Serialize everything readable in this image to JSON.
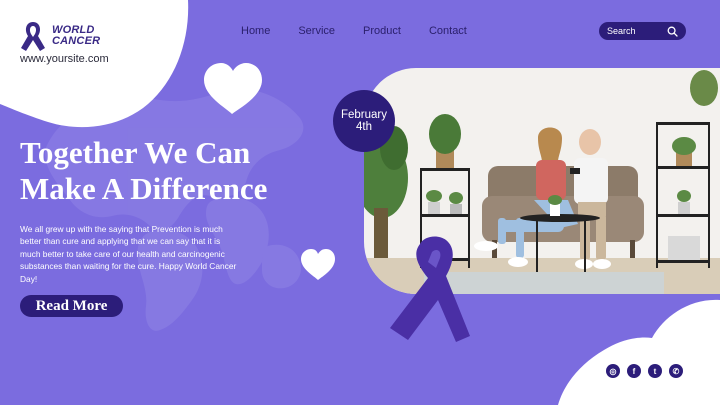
{
  "brand": {
    "name_line1": "WORLD",
    "name_line2": "CANCER",
    "site_url": "www.yoursite.com"
  },
  "nav": {
    "items": [
      {
        "label": "Home"
      },
      {
        "label": "Service"
      },
      {
        "label": "Product"
      },
      {
        "label": "Contact"
      }
    ]
  },
  "search": {
    "label": "Search",
    "icon": "search-icon"
  },
  "hero": {
    "headline_line1": "Together We Can",
    "headline_line2": "Make A Difference",
    "body": "We all grew up with the saying that Prevention is much better than cure and applying that we can say that it is much better to take care of our health and carcinogenic substances than waiting for the cure. Happy World Cancer Day!",
    "cta_label": "Read More"
  },
  "date_badge": {
    "line1": "February",
    "line2": "4th"
  },
  "socials": [
    {
      "icon": "instagram-icon",
      "glyph": "◎"
    },
    {
      "icon": "facebook-icon",
      "glyph": "f"
    },
    {
      "icon": "twitter-icon",
      "glyph": "t"
    },
    {
      "icon": "whatsapp-icon",
      "glyph": "✆"
    }
  ],
  "colors": {
    "background": "#7b6cdf",
    "accent_dark": "#2c1d7a",
    "ribbon": "#4a2fa5",
    "white": "#ffffff"
  }
}
